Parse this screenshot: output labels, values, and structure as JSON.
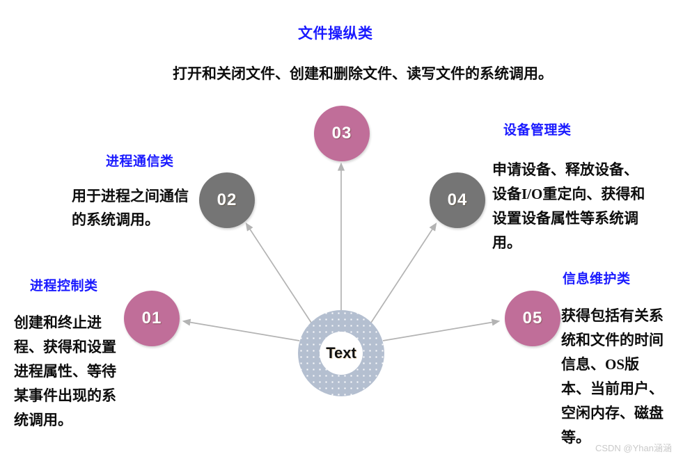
{
  "slide": {
    "title": "文件操纵类",
    "subtitle": "打开和关闭文件、创建和删除文件、读写文件的系统调用。",
    "center_label": "Text",
    "watermark": "CSDN @Yhan涵涵"
  },
  "colors": {
    "heading": "#1a1aff",
    "body": "#0d0d0d",
    "node_pink": "#c06e99",
    "node_gray": "#757575",
    "center_ring": "#b4bfd0",
    "arrow": "#b3b3b3",
    "background": "#ffffff",
    "watermark": "#c9c9c9"
  },
  "nodes": [
    {
      "number": "01",
      "color": "pink",
      "category": "进程控制类"
    },
    {
      "number": "02",
      "color": "gray",
      "category": "进程通信类"
    },
    {
      "number": "03",
      "color": "pink",
      "category": "文件操纵类"
    },
    {
      "number": "04",
      "color": "gray",
      "category": "设备管理类"
    },
    {
      "number": "05",
      "color": "pink",
      "category": "信息维护类"
    }
  ],
  "categories": {
    "process_control": {
      "heading": "进程控制类",
      "body": "创建和终止进程、获得和设置进程属性、等待某事件出现的系统调用。"
    },
    "ipc": {
      "heading": "进程通信类",
      "body": "用于进程之间通信的系统调用。"
    },
    "file_manipulation": {
      "heading": "文件操纵类",
      "body": "打开和关闭文件、创建和删除文件、读写文件的系统调用。"
    },
    "device_management": {
      "heading": "设备管理类",
      "body": "申请设备、释放设备、设备I/O重定向、获得和设置设备属性等系统调用。"
    },
    "information_maintenance": {
      "heading": "信息维护类",
      "body": "获得包括有关系统和文件的时间信息、OS版本、当前用户、空闲内存、磁盘等。"
    }
  }
}
